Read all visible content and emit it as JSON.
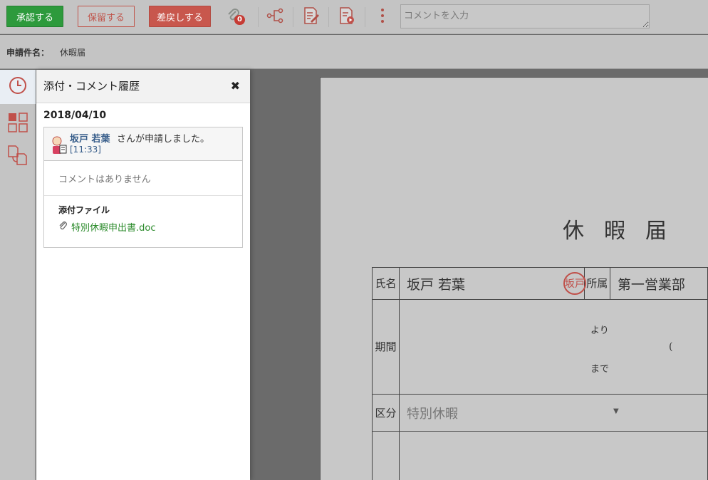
{
  "toolbar": {
    "approve_label": "承認する",
    "hold_label": "保留する",
    "reject_label": "差戻しする",
    "attachment_count": "0",
    "comment_placeholder": "コメントを入力"
  },
  "subject": {
    "label": "申請件名：",
    "value": "休暇届"
  },
  "panel": {
    "title": "添付・コメント履歴",
    "close_icon": "×",
    "date": "2018/04/10",
    "entry": {
      "user": "坂戸 若葉",
      "action": "さんが申請しました。",
      "time": "[11:33]",
      "no_comment": "コメントはありません",
      "attachment_label": "添付ファイル",
      "attachment_file": "特別休暇申出書.doc"
    }
  },
  "document": {
    "title": "休暇届",
    "name_label": "氏名",
    "name_value": "坂戸 若葉",
    "seal_text": "坂戸",
    "dept_label": "所属",
    "dept_value": "第一営業部",
    "period_label": "期間",
    "from_text": "より",
    "to_text": "まで",
    "paren": "(",
    "type_label": "区分",
    "type_value": "特別休暇"
  },
  "colors": {
    "approve": "#2d9a3c",
    "reject": "#c8574d",
    "link": "#375d8a",
    "file": "#2a8a2a"
  },
  "icons": [
    "attachment-icon",
    "route-icon",
    "edit-doc-icon",
    "preview-doc-icon",
    "more-icon",
    "history-icon",
    "grid-icon",
    "documents-icon",
    "paperclip-icon"
  ]
}
